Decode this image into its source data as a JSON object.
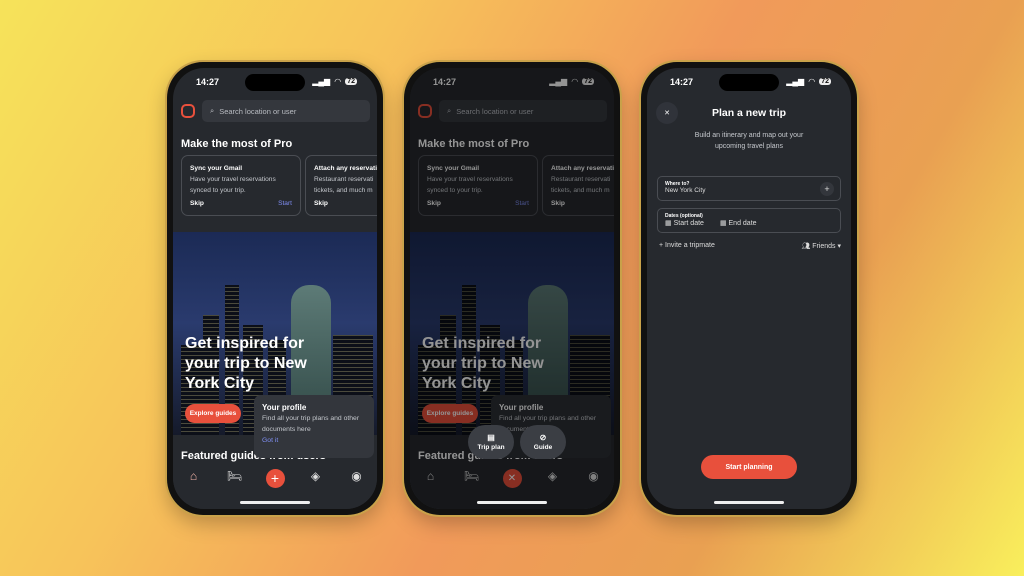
{
  "status": {
    "time": "14:27",
    "battery": "72"
  },
  "home": {
    "search_placeholder": "Search location or user",
    "pro_heading": "Make the most of Pro",
    "cards": [
      {
        "title": "Sync your Gmail",
        "body": "Have your travel reservations synced to your trip.",
        "skip": "Skip",
        "start": "Start"
      },
      {
        "title": "Attach any reservati",
        "body": "Restaurant reservati tickets, and much m",
        "skip": "Skip"
      }
    ],
    "headline": "Get inspired for your trip to New York City",
    "explore": "Explore guides",
    "featured": "Featured guides from users",
    "tooltip": {
      "title": "Your profile",
      "body": "Find all your trip plans and other documents here",
      "got_it": "Got it"
    }
  },
  "nav": {
    "icons": [
      "home-icon",
      "bed-icon",
      "plus-icon",
      "tag-icon",
      "profile-icon"
    ]
  },
  "menu": {
    "trip_plan": "Trip plan",
    "guide": "Guide"
  },
  "plan": {
    "title": "Plan a new trip",
    "subtitle": "Build an itinerary and map out your upcoming travel plans",
    "where_label": "Where to?",
    "where_value": "New York City",
    "dates_label": "Dates (optional)",
    "start_date": "Start date",
    "end_date": "End date",
    "invite": "Invite a tripmate",
    "friends": "Friends",
    "start_button": "Start planning"
  },
  "colors": {
    "accent": "#e8503c",
    "link": "#7e8cf0",
    "bg": "#26292e"
  }
}
